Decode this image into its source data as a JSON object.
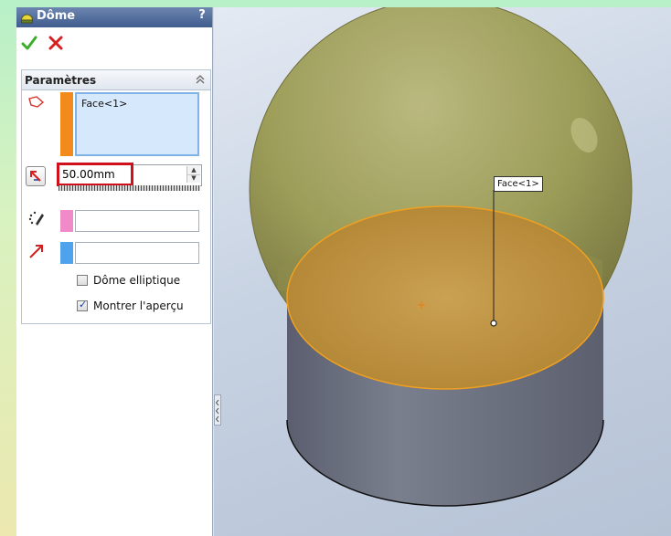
{
  "feature": {
    "title": "Dôme",
    "help_label": "?"
  },
  "parameters": {
    "section_title": "Paramètres",
    "faces": [
      "Face<1>"
    ],
    "distance_value": "50.00mm",
    "elliptical_dome_label": "Dôme elliptique",
    "elliptical_dome_checked": false,
    "show_preview_label": "Montrer l'aperçu",
    "show_preview_checked": true
  },
  "viewport": {
    "callout_label": "Face<1>"
  },
  "colors": {
    "face_swatch": "#f28a1c",
    "constraint_swatch": "#f08ac8",
    "direction_swatch": "#4fa3ec",
    "dome": "#8a8a3a",
    "selected_face": "#c88a2a",
    "cylinder": "#6b6f7e"
  }
}
